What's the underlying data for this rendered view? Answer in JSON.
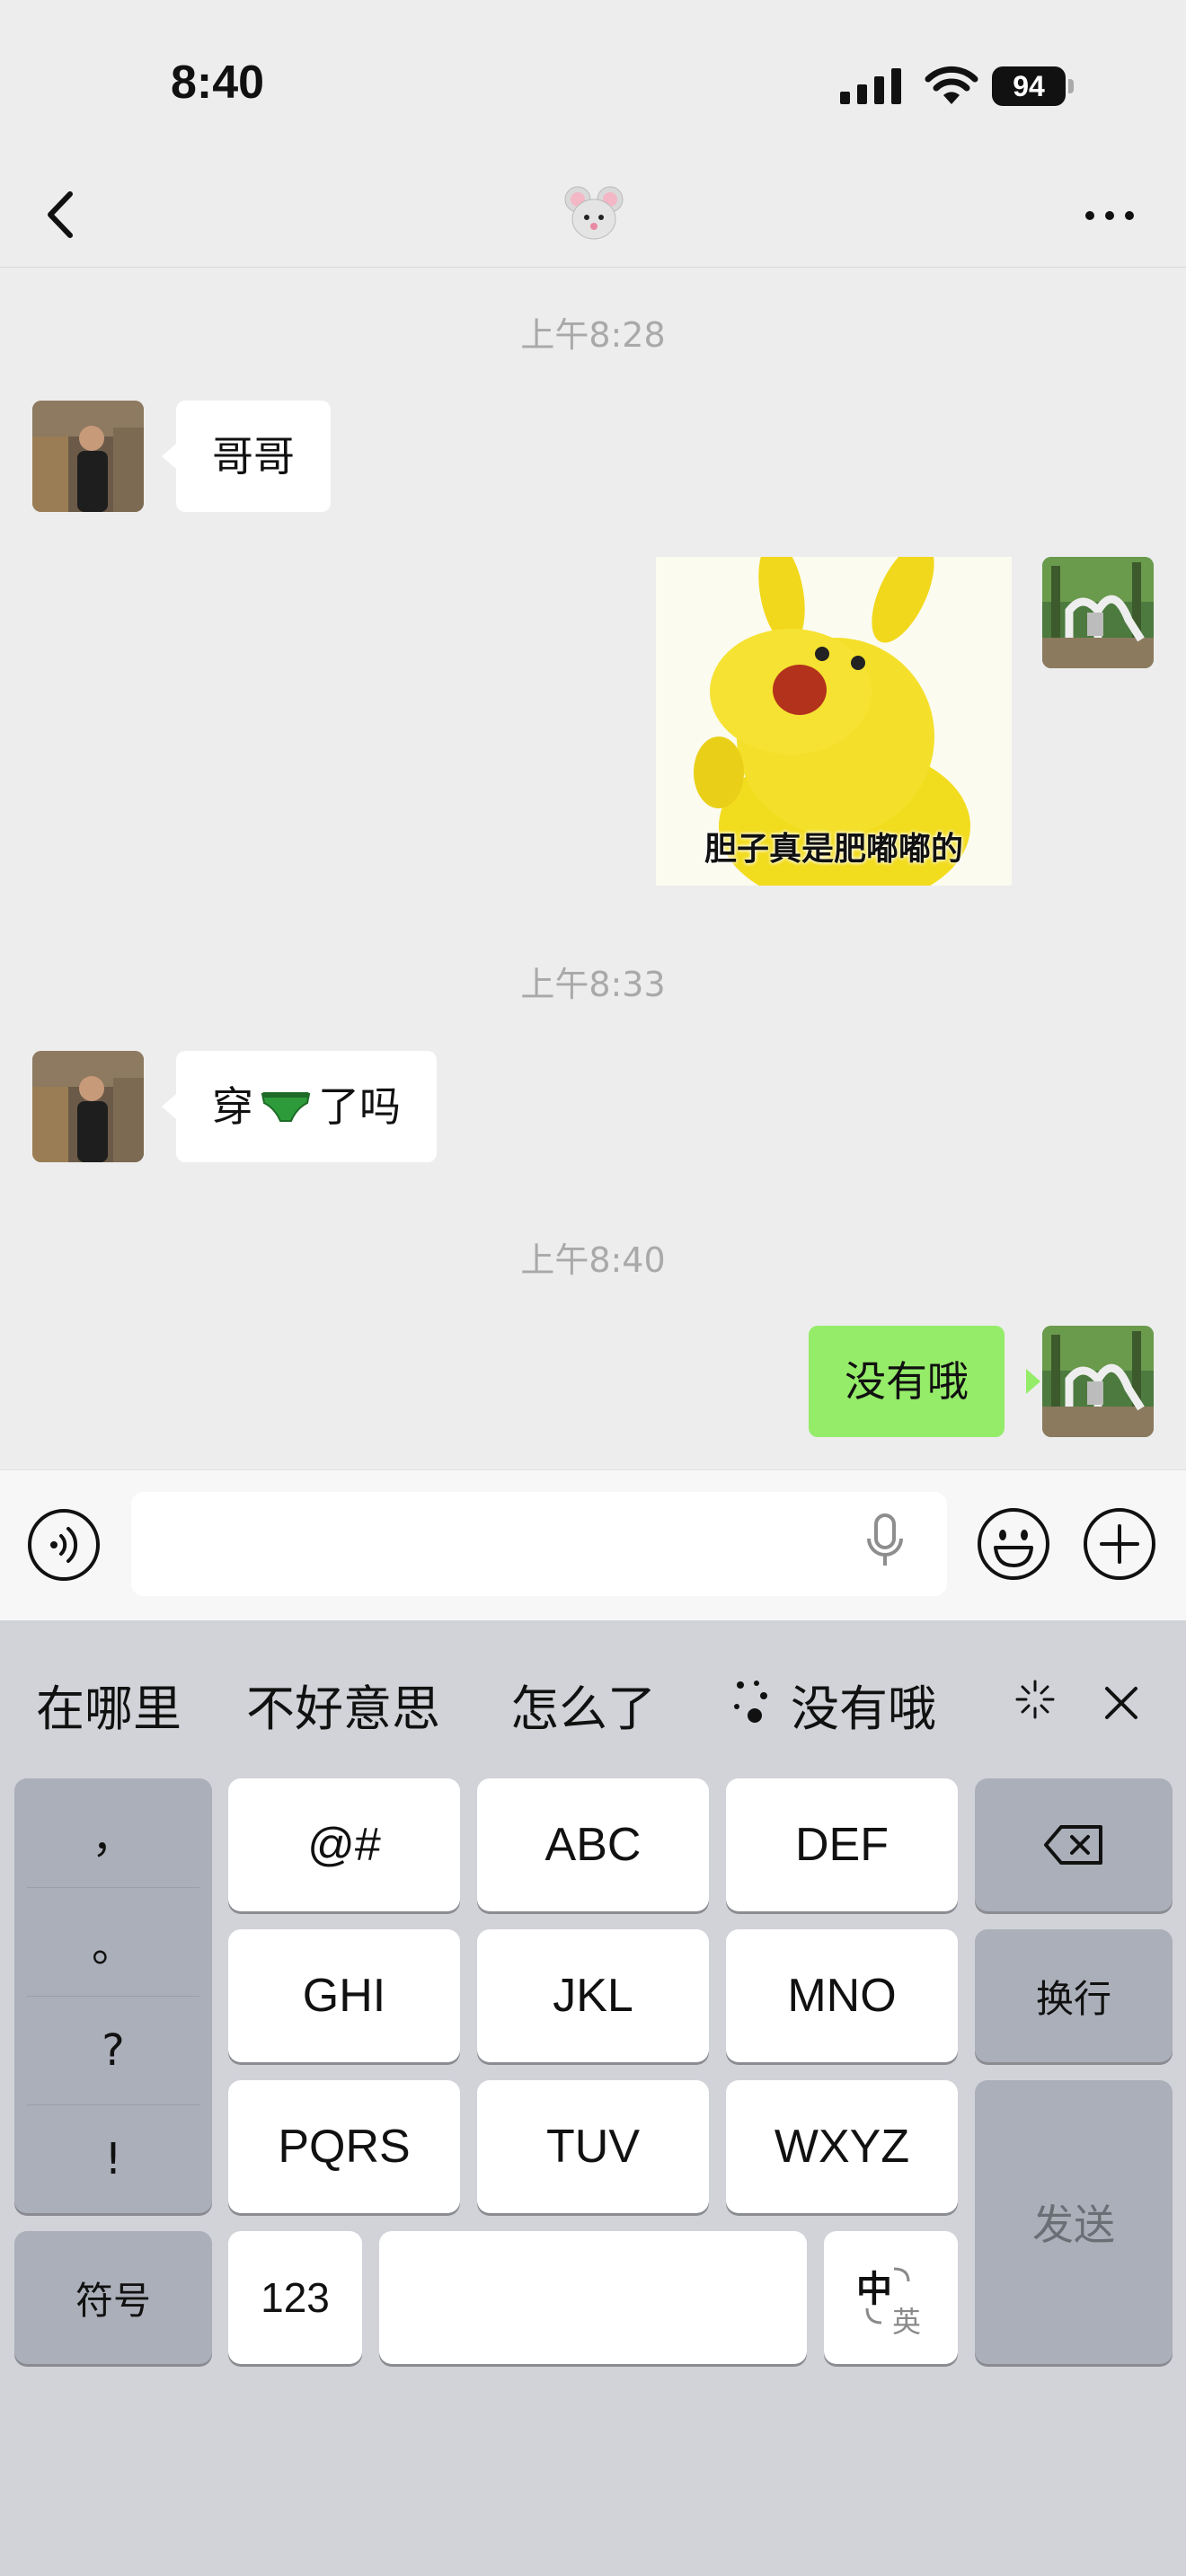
{
  "status_bar": {
    "time": "8:40",
    "battery": "94",
    "icons": [
      "signal-icon",
      "wifi-icon",
      "battery-icon"
    ]
  },
  "nav": {
    "title_icon": "mouse-emoji",
    "back_icon": "chevron-left-icon",
    "more_icon": "more-icon"
  },
  "messages": [
    {
      "type": "timestamp",
      "text": "上午8:28"
    },
    {
      "type": "text",
      "direction": "incoming",
      "text": "哥哥"
    },
    {
      "type": "sticker",
      "direction": "outgoing",
      "caption": "胆子真是肥嘟嘟的"
    },
    {
      "type": "timestamp",
      "text": "上午8:33"
    },
    {
      "type": "text",
      "direction": "incoming",
      "text_before": "穿",
      "emoji": "green-underwear-emoji",
      "text_after": "了吗"
    },
    {
      "type": "timestamp",
      "text": "上午8:40"
    },
    {
      "type": "text",
      "direction": "outgoing",
      "text": "没有哦"
    }
  ],
  "input_bar": {
    "value": "",
    "icons": [
      "voice-icon",
      "mic-icon",
      "emoji-icon",
      "plus-icon"
    ]
  },
  "keyboard": {
    "suggestions": [
      "在哪里",
      "不好意思",
      "怎么了",
      "没有哦"
    ],
    "suggestion_sparkle_icon": "sparkle-icon",
    "punctuation": [
      "，",
      "。",
      "?",
      "!"
    ],
    "symbols_label": "符号",
    "keys_row1": [
      "@#",
      "ABC",
      "DEF"
    ],
    "keys_row2": [
      "GHI",
      "JKL",
      "MNO"
    ],
    "keys_row3": [
      "PQRS",
      "TUV",
      "WXYZ"
    ],
    "newline_label": "换行",
    "send_label": "发送",
    "numbers_label": "123",
    "lang_zh": "中",
    "lang_en": "英",
    "colors": {
      "bubble_out": "#95ec69",
      "bubble_in": "#ffffff",
      "keyboard_bg": "#d1d3d9"
    }
  }
}
